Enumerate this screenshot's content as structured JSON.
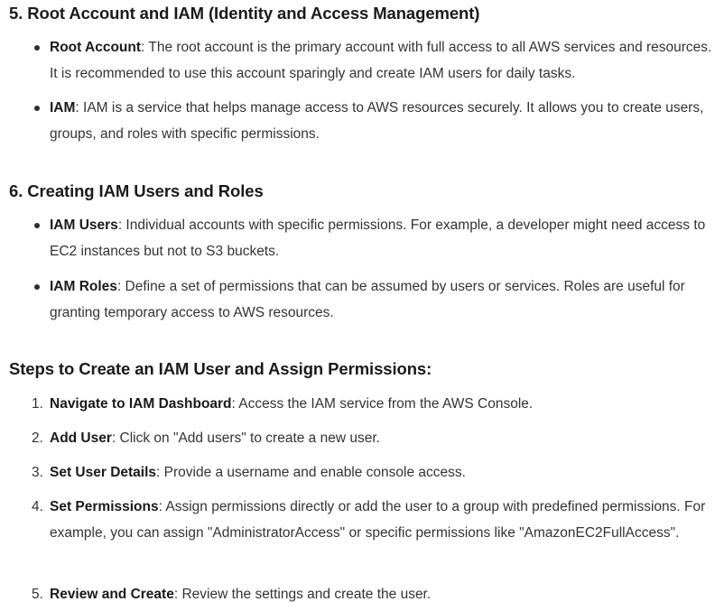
{
  "section5": {
    "heading": "5. Root Account and IAM (Identity and Access Management)",
    "items": [
      {
        "term": "Root Account",
        "text": ": The root account is the primary account with full access to all AWS services and resources. It is recommended to use this account sparingly and create IAM users for daily tasks."
      },
      {
        "term": "IAM",
        "text": ": IAM is a service that helps manage access to AWS resources securely. It allows you to create users, groups, and roles with specific permissions."
      }
    ]
  },
  "section6": {
    "heading": "6. Creating IAM Users and Roles",
    "items": [
      {
        "term": "IAM Users",
        "text": ": Individual accounts with specific permissions. For example, a developer might need access to EC2 instances but not to S3 buckets."
      },
      {
        "term": "IAM Roles",
        "text": ": Define a set of permissions that can be assumed by users or services. Roles are useful for granting temporary access to AWS resources."
      }
    ]
  },
  "steps": {
    "heading": "Steps to Create an IAM User and Assign Permissions:",
    "items": [
      {
        "number": "1.",
        "term": "Navigate to IAM Dashboard",
        "text": ": Access the IAM service from the AWS Console."
      },
      {
        "number": "2.",
        "term": "Add User",
        "text": ": Click on \"Add users\" to create a new user."
      },
      {
        "number": "3.",
        "term": "Set User Details",
        "text": ": Provide a username and enable console access."
      },
      {
        "number": "4.",
        "term": "Set Permissions",
        "text": ": Assign permissions directly or add the user to a group with predefined permissions. For example, you can assign \"AdministratorAccess\" or specific permissions like \"AmazonEC2FullAccess\"."
      },
      {
        "number": "5.",
        "term": "Review and Create",
        "text": ": Review the settings and create the user."
      }
    ]
  }
}
